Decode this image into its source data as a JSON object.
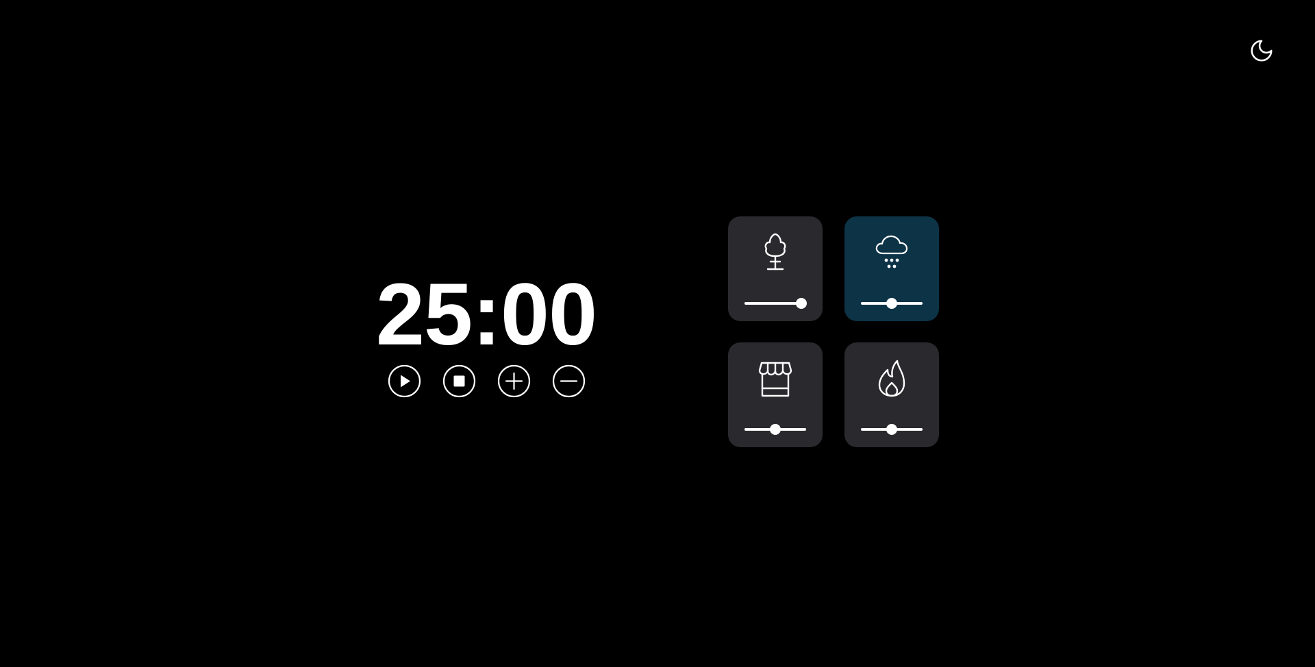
{
  "timer": {
    "display": "25:00"
  },
  "controls": [
    {
      "name": "play-button",
      "icon": "play-icon"
    },
    {
      "name": "stop-button",
      "icon": "stop-icon"
    },
    {
      "name": "increase-time-button",
      "icon": "plus-icon"
    },
    {
      "name": "decrease-time-button",
      "icon": "minus-icon"
    }
  ],
  "theme_toggle": {
    "icon": "moon-icon"
  },
  "sounds": [
    {
      "id": "forest",
      "icon": "tree-icon",
      "active": false,
      "volume": 0.92
    },
    {
      "id": "rain",
      "icon": "cloud-rain-icon",
      "active": true,
      "volume": 0.5
    },
    {
      "id": "coffee-shop",
      "icon": "store-icon",
      "active": false,
      "volume": 0.5
    },
    {
      "id": "fireplace",
      "icon": "fire-icon",
      "active": false,
      "volume": 0.5
    }
  ],
  "colors": {
    "background": "#000000",
    "card": "#2a2a2e",
    "card_active": "#0d3347",
    "foreground": "#ffffff"
  }
}
